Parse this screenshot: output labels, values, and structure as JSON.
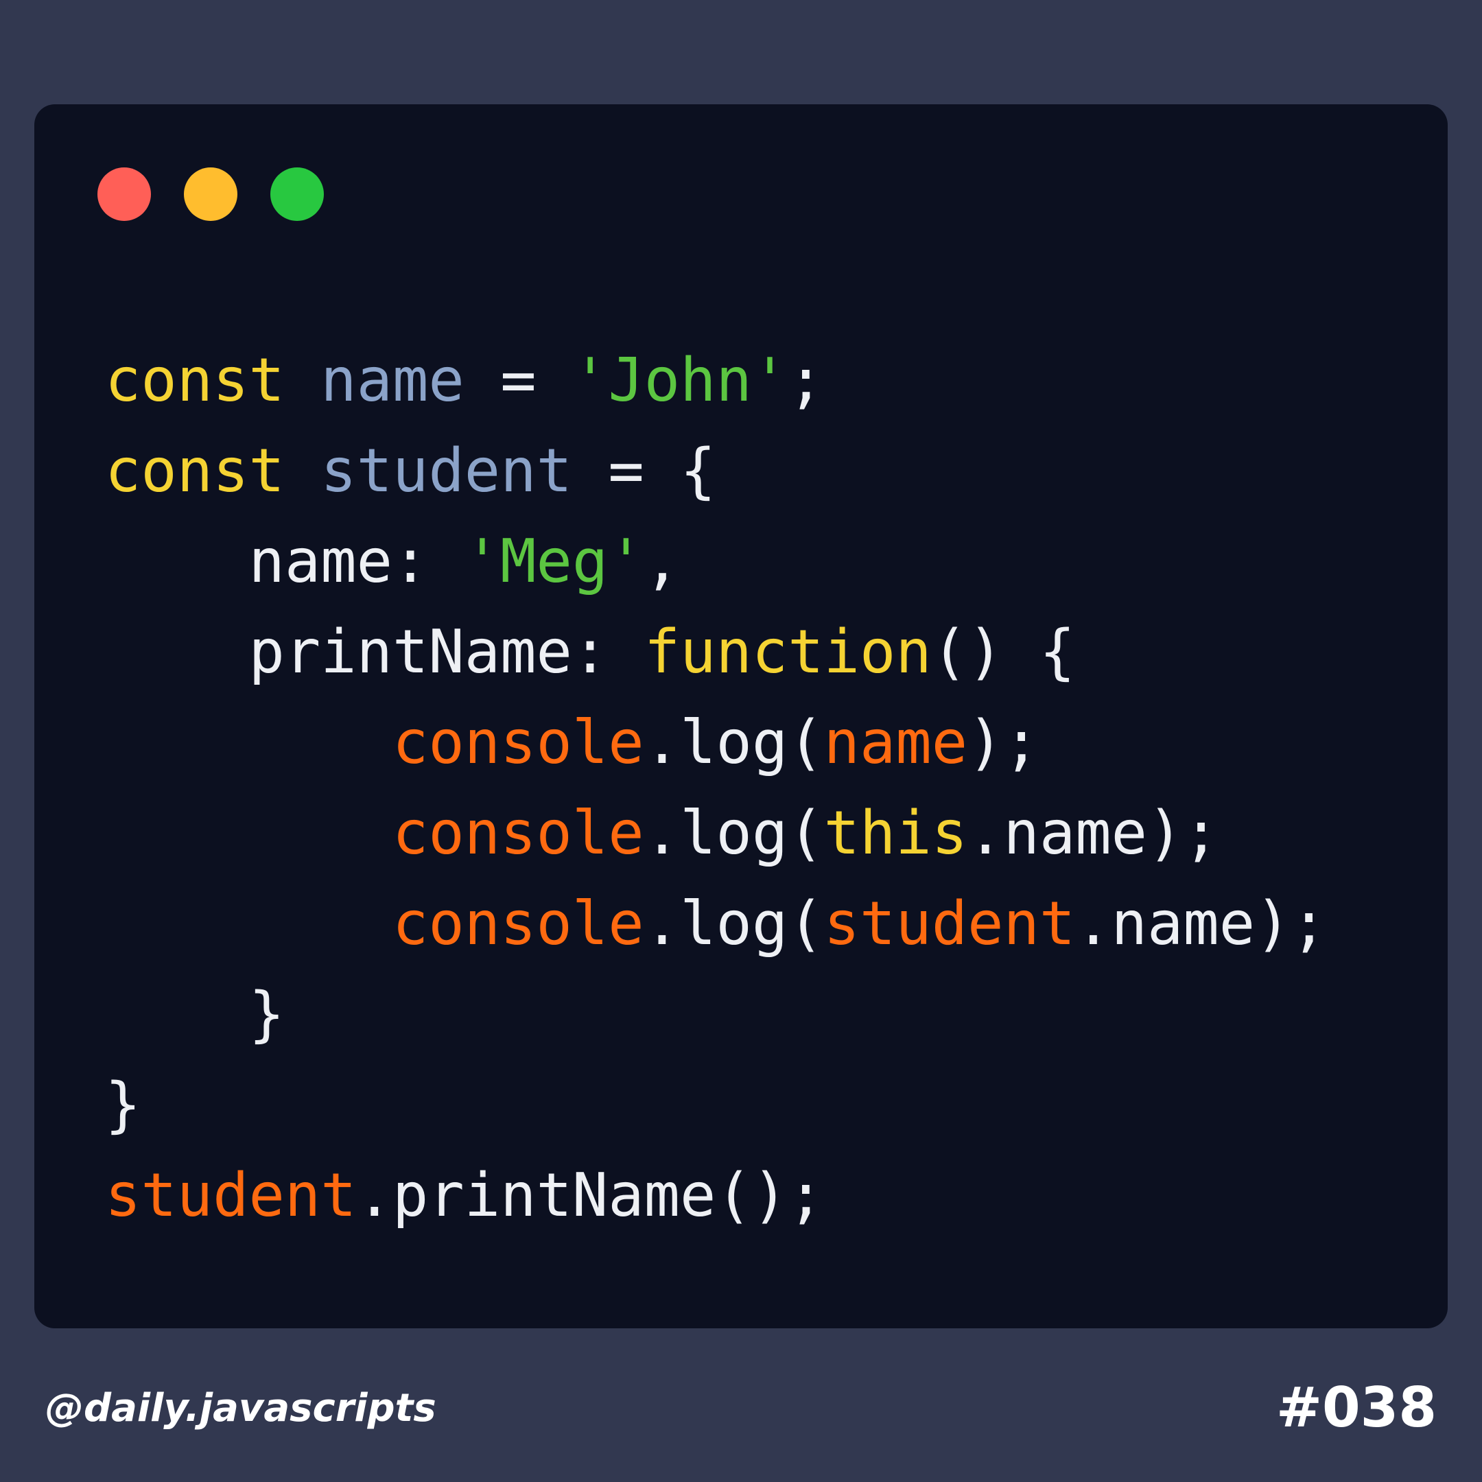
{
  "colors": {
    "page_background": "#323850",
    "window_background": "#0c1020",
    "light_red": "#ff5f57",
    "light_yellow": "#ffbd2e",
    "light_green": "#28c840",
    "keyword": "#f5d333",
    "identifier": "#8ba3c9",
    "string": "#5cc641",
    "plain": "#eef0f4",
    "object": "#ff6a10"
  },
  "window": {
    "traffic_lights": [
      "close",
      "minimize",
      "maximize"
    ]
  },
  "code": {
    "lines": [
      [
        {
          "text": "const",
          "color": "keyword"
        },
        {
          "text": " ",
          "color": "plain"
        },
        {
          "text": "name",
          "color": "identifier"
        },
        {
          "text": " = ",
          "color": "plain"
        },
        {
          "text": "'John'",
          "color": "string"
        },
        {
          "text": ";",
          "color": "plain"
        }
      ],
      [
        {
          "text": "const",
          "color": "keyword"
        },
        {
          "text": " ",
          "color": "plain"
        },
        {
          "text": "student",
          "color": "identifier"
        },
        {
          "text": " = {",
          "color": "plain"
        }
      ],
      [
        {
          "text": "    name: ",
          "color": "plain"
        },
        {
          "text": "'Meg'",
          "color": "string"
        },
        {
          "text": ",",
          "color": "plain"
        }
      ],
      [
        {
          "text": "    printName: ",
          "color": "plain"
        },
        {
          "text": "function",
          "color": "keyword"
        },
        {
          "text": "() {",
          "color": "plain"
        }
      ],
      [
        {
          "text": "        ",
          "color": "plain"
        },
        {
          "text": "console",
          "color": "object"
        },
        {
          "text": ".log(",
          "color": "plain"
        },
        {
          "text": "name",
          "color": "object"
        },
        {
          "text": ");",
          "color": "plain"
        }
      ],
      [
        {
          "text": "        ",
          "color": "plain"
        },
        {
          "text": "console",
          "color": "object"
        },
        {
          "text": ".log(",
          "color": "plain"
        },
        {
          "text": "this",
          "color": "keyword"
        },
        {
          "text": ".name);",
          "color": "plain"
        }
      ],
      [
        {
          "text": "        ",
          "color": "plain"
        },
        {
          "text": "console",
          "color": "object"
        },
        {
          "text": ".log(",
          "color": "plain"
        },
        {
          "text": "student",
          "color": "object"
        },
        {
          "text": ".name);",
          "color": "plain"
        }
      ],
      [
        {
          "text": "    }",
          "color": "plain"
        }
      ],
      [
        {
          "text": "}",
          "color": "plain"
        }
      ],
      [
        {
          "text": "student",
          "color": "object"
        },
        {
          "text": ".printName();",
          "color": "plain"
        }
      ]
    ]
  },
  "footer": {
    "handle": "@daily.javascripts",
    "number": "#038"
  }
}
